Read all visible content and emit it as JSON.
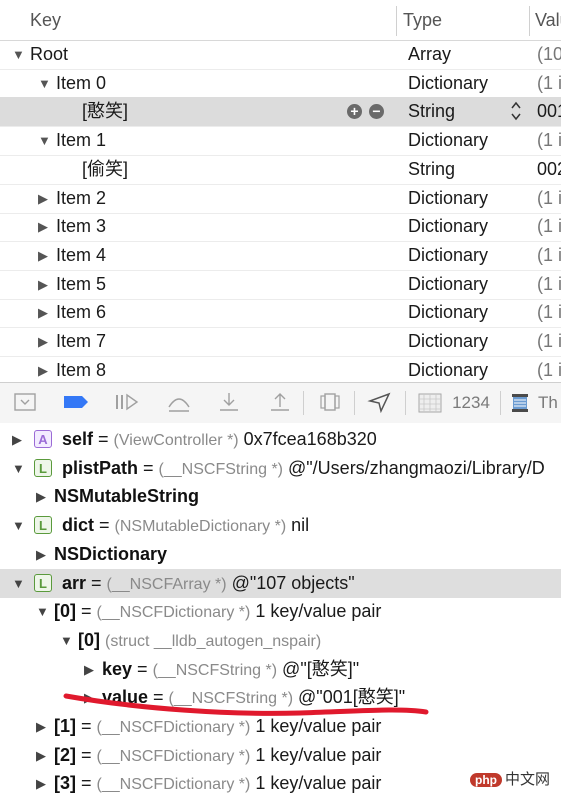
{
  "plist": {
    "columns": {
      "key": "Key",
      "type": "Type",
      "value": "Valu"
    },
    "rows": [
      {
        "key": "Root",
        "type": "Array",
        "value": "(10",
        "tri": "▼",
        "indent": 0,
        "selected": false
      },
      {
        "key": "Item 0",
        "type": "Dictionary",
        "value": "(1 i",
        "tri": "▼",
        "indent": 1,
        "selected": false
      },
      {
        "key": "[憨笑]",
        "type": "String",
        "value": "001",
        "tri": "",
        "indent": 2,
        "selected": true
      },
      {
        "key": "Item 1",
        "type": "Dictionary",
        "value": "(1 i",
        "tri": "▼",
        "indent": 1,
        "selected": false
      },
      {
        "key": "[偷笑]",
        "type": "String",
        "value": "002",
        "tri": "",
        "indent": 2,
        "selected": false
      },
      {
        "key": "Item 2",
        "type": "Dictionary",
        "value": "(1 i",
        "tri": "▶",
        "indent": 1,
        "selected": false
      },
      {
        "key": "Item 3",
        "type": "Dictionary",
        "value": "(1 i",
        "tri": "▶",
        "indent": 1,
        "selected": false
      },
      {
        "key": "Item 4",
        "type": "Dictionary",
        "value": "(1 i",
        "tri": "▶",
        "indent": 1,
        "selected": false
      },
      {
        "key": "Item 5",
        "type": "Dictionary",
        "value": "(1 i",
        "tri": "▶",
        "indent": 1,
        "selected": false
      },
      {
        "key": "Item 6",
        "type": "Dictionary",
        "value": "(1 i",
        "tri": "▶",
        "indent": 1,
        "selected": false
      },
      {
        "key": "Item 7",
        "type": "Dictionary",
        "value": "(1 i",
        "tri": "▶",
        "indent": 1,
        "selected": false
      },
      {
        "key": "Item 8",
        "type": "Dictionary",
        "value": "(1 i",
        "tri": "▶",
        "indent": 1,
        "selected": false
      }
    ],
    "plus": "+",
    "minus": "−"
  },
  "toolbar": {
    "frame_label": "1234",
    "thread_label": "Th",
    "icons": [
      "hide-panel-icon",
      "breakpoint-icon",
      "continue-icon",
      "step-over-icon",
      "step-into-icon",
      "step-out-icon",
      "view-hierarchy-icon",
      "location-icon",
      "frame-icon",
      "thread-icon"
    ],
    "accent": "#3478f6"
  },
  "vars": {
    "rows": [
      {
        "tri": "▶",
        "badge": "A",
        "name": "self",
        "eq": " = ",
        "type": "(ViewController *)",
        "value": " 0x7fcea168b320",
        "indent": 0,
        "selected": false
      },
      {
        "tri": "▼",
        "badge": "L",
        "name": "plistPath",
        "eq": " = ",
        "type": "(__NSCFString *)",
        "value": " @\"/Users/zhangmaozi/Library/D",
        "indent": 0,
        "selected": false
      },
      {
        "tri": "▶",
        "badge": "",
        "name": "NSMutableString",
        "eq": "",
        "type": "",
        "value": "",
        "indent": 1,
        "selected": false
      },
      {
        "tri": "▼",
        "badge": "L",
        "name": "dict",
        "eq": " = ",
        "type": "(NSMutableDictionary *)",
        "value": " nil",
        "indent": 0,
        "selected": false
      },
      {
        "tri": "▶",
        "badge": "",
        "name": "NSDictionary",
        "eq": "",
        "type": "",
        "value": "",
        "indent": 1,
        "selected": false
      },
      {
        "tri": "▼",
        "badge": "L",
        "name": "arr",
        "eq": " = ",
        "type": "(__NSCFArray *)",
        "value": " @\"107 objects\"",
        "indent": 0,
        "selected": true
      },
      {
        "tri": "▼",
        "badge": "",
        "name": "[0]",
        "eq": " = ",
        "type": "(__NSCFDictionary *)",
        "value": " 1 key/value pair",
        "indent": 1,
        "selected": false
      },
      {
        "tri": "▼",
        "badge": "",
        "name": "[0]",
        "eq": " ",
        "type": "(struct __lldb_autogen_nspair)",
        "value": "",
        "indent": 2,
        "selected": false
      },
      {
        "tri": "▶",
        "badge": "",
        "name": "key",
        "eq": " = ",
        "type": "(__NSCFString *)",
        "value": " @\"[憨笑]\"",
        "indent": 3,
        "selected": false
      },
      {
        "tri": "▶",
        "badge": "",
        "name": "value",
        "eq": " = ",
        "type": "(__NSCFString *)",
        "value": " @\"001[憨笑]\"",
        "indent": 3,
        "selected": false
      },
      {
        "tri": "▶",
        "badge": "",
        "name": "[1]",
        "eq": " = ",
        "type": "(__NSCFDictionary *)",
        "value": " 1 key/value pair",
        "indent": 1,
        "selected": false
      },
      {
        "tri": "▶",
        "badge": "",
        "name": "[2]",
        "eq": " = ",
        "type": "(__NSCFDictionary *)",
        "value": " 1 key/value pair",
        "indent": 1,
        "selected": false
      },
      {
        "tri": "▶",
        "badge": "",
        "name": "[3]",
        "eq": " = ",
        "type": "(__NSCFDictionary *)",
        "value": " 1 key/value pair",
        "indent": 1,
        "selected": false
      }
    ]
  },
  "annotation": {
    "color": "#e0192d"
  },
  "watermark": {
    "logo": "php",
    "text": "中文网"
  }
}
